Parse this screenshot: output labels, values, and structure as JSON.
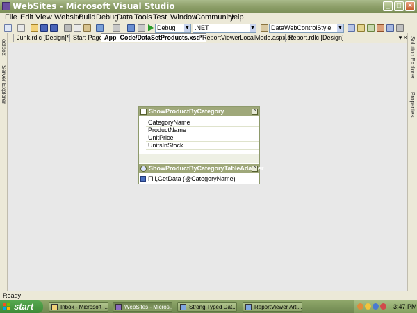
{
  "window": {
    "title": "WebSites - Microsoft Visual Studio",
    "minimize_glyph": "_",
    "maximize_glyph": "□",
    "close_glyph": "×"
  },
  "menu": [
    "File",
    "Edit",
    "View",
    "Website",
    "Build",
    "Debug",
    "Data",
    "Tools",
    "Test",
    "Window",
    "Community",
    "Help"
  ],
  "toolbar": {
    "config": "Debug",
    "platform": ".NET",
    "style": "DataWebControlStyle"
  },
  "tabs": [
    {
      "label": "Junk.rdlc [Design]*"
    },
    {
      "label": "Start Page"
    },
    {
      "label": "App_Code/DataSetProducts.xsd*"
    },
    {
      "label": "ReportViewerLocalMode.aspx.cs"
    },
    {
      "label": "Report.rdlc [Design]"
    }
  ],
  "tab_controls": "▾ ×",
  "left_dock": [
    "Toolbox",
    "Server Explorer"
  ],
  "right_dock": [
    "Solution Explorer",
    "Properties"
  ],
  "datatable": {
    "name": "ShowProductByCategory",
    "columns": [
      "CategoryName",
      "ProductName",
      "UnitPrice",
      "UnitsInStock"
    ],
    "adapter": "ShowProductByCategoryTableAdapter",
    "query": "Fill,GetData (@CategoryName)",
    "collapse_glyph": "^"
  },
  "status": "Ready",
  "taskbar": {
    "start": "start",
    "items": [
      {
        "label": "Inbox - Microsoft ..."
      },
      {
        "label": "WebSites - Micros..."
      },
      {
        "label": "Strong Typed Dat..."
      },
      {
        "label": "ReportViewer Arti..."
      }
    ],
    "clock": "3:47 PM"
  },
  "colors": {
    "header": "#9fa87a",
    "titlebar": "#8ea06a",
    "taskbar": "#7c9558"
  }
}
